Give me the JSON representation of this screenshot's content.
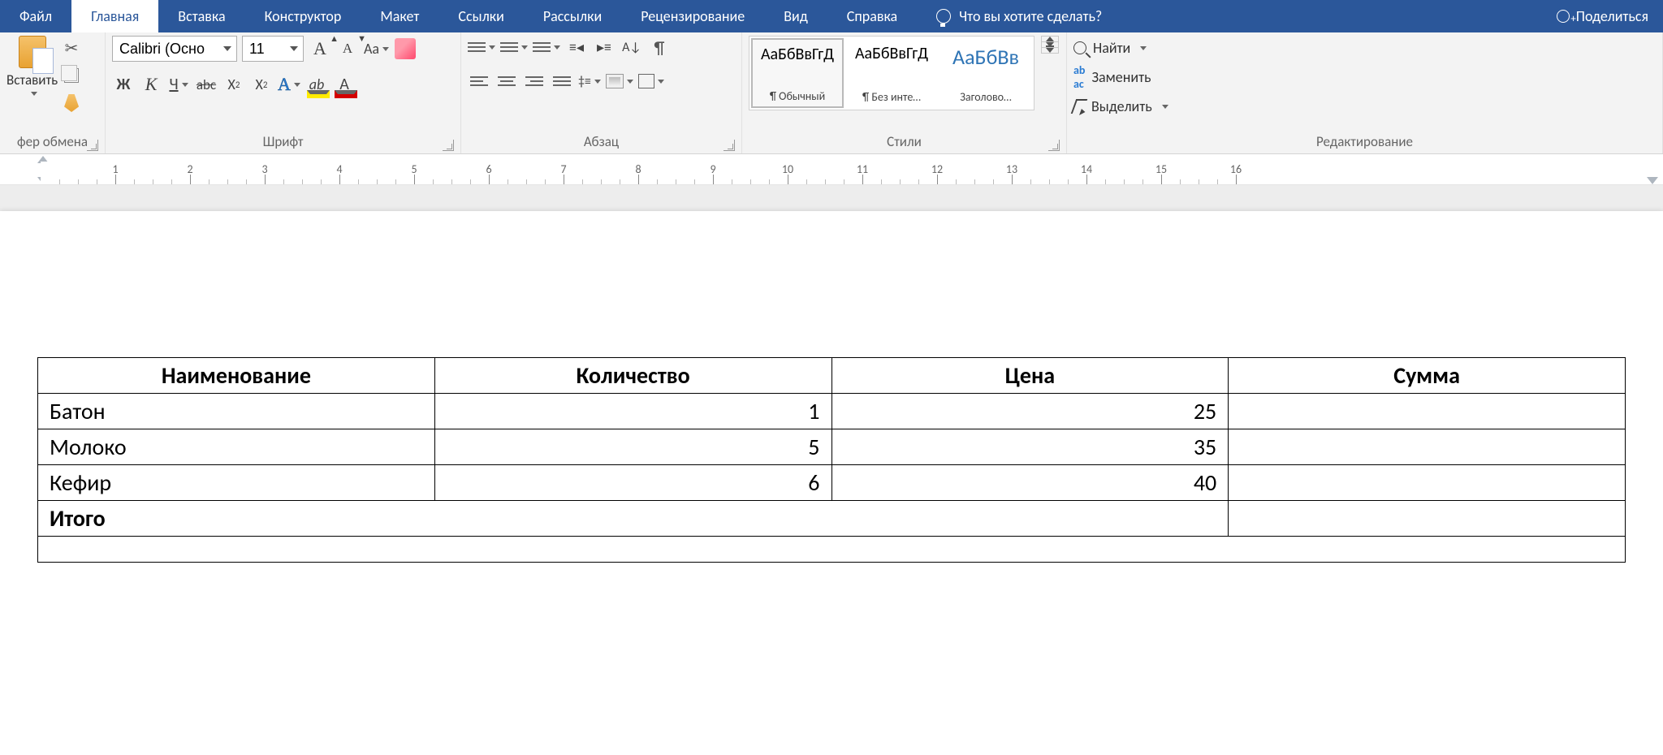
{
  "tabs": {
    "file": "Файл",
    "home": "Главная",
    "insert": "Вставка",
    "design": "Конструктор",
    "layout": "Макет",
    "references": "Ссылки",
    "mailings": "Рассылки",
    "review": "Рецензирование",
    "view": "Вид",
    "help": "Справка",
    "tell_me": "Что вы хотите сделать?",
    "share": "Поделиться"
  },
  "ribbon": {
    "clipboard": {
      "paste": "Вставить",
      "title": "фер обмена"
    },
    "font": {
      "name_value": "Calibri (Осно",
      "size_value": "11",
      "title": "Шрифт",
      "bold": "Ж",
      "italic": "К",
      "underline": "Ч",
      "strike": "abc",
      "sub": "X",
      "sup": "X",
      "grow": "А",
      "shrink": "А",
      "case": "Aa",
      "effects": "А",
      "highlight": "ab",
      "color": "А"
    },
    "paragraph": {
      "title": "Абзац"
    },
    "styles": {
      "title": "Стили",
      "items": [
        {
          "preview": "АаБбВвГгД",
          "name": "¶ Обычный",
          "selected": true
        },
        {
          "preview": "АаБбВвГгД",
          "name": "¶ Без инте…",
          "selected": false
        },
        {
          "preview": "АаБбВв",
          "name": "Заголово…",
          "selected": false,
          "color": "#2e74b5",
          "big": true
        }
      ]
    },
    "editing": {
      "find": "Найти",
      "replace": "Заменить",
      "select": "Выделить",
      "title": "Редактирование"
    }
  },
  "ruler": {
    "unit_count": 16
  },
  "table": {
    "headers": [
      "Наименование",
      "Количество",
      "Цена",
      "Сумма"
    ],
    "rows": [
      {
        "name": "Батон",
        "qty": "1",
        "price": "25",
        "sum": ""
      },
      {
        "name": "Молоко",
        "qty": "5",
        "price": "35",
        "sum": ""
      },
      {
        "name": "Кефир",
        "qty": "6",
        "price": "40",
        "sum": ""
      }
    ],
    "total_label": "Итого"
  }
}
